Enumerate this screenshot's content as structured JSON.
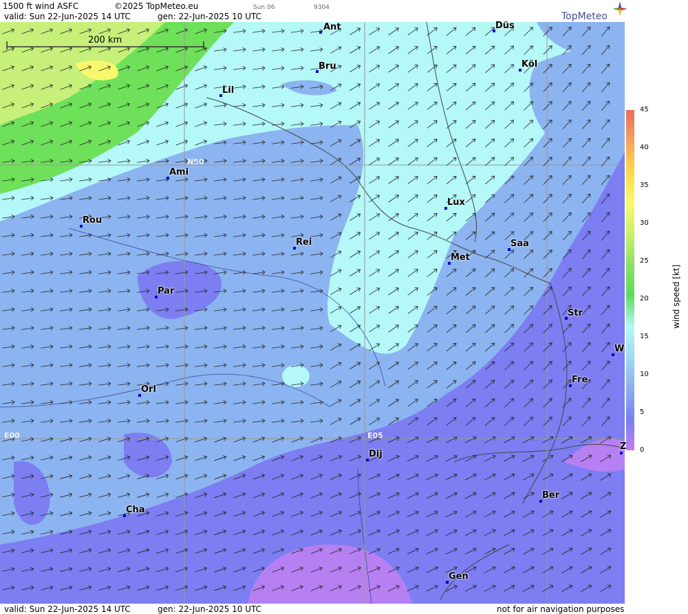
{
  "header": {
    "title": "1500 ft wind ASFC",
    "copyright": "©2025 TopMeteo.eu",
    "run_label": "Sun 06",
    "code": "9304",
    "valid_top": "valid:  Sun  22-Jun-2025  14 UTC",
    "gen_top": "gen: 22-Jun-2025 10 UTC",
    "logo": "TopMeteo"
  },
  "footer": {
    "valid": "valid:  Sun  22-Jun-2025  14 UTC",
    "gen": "gen: 22-Jun-2025 10 UTC",
    "disclaimer": "not for air navigation purposes"
  },
  "scale": {
    "label": "200 km"
  },
  "grid_labels": {
    "n50": "N50",
    "e00": "E00",
    "e05": "E05"
  },
  "cities": [
    {
      "name": "Ant"
    },
    {
      "name": "Düs"
    },
    {
      "name": "Köl"
    },
    {
      "name": "Bru"
    },
    {
      "name": "Lil"
    },
    {
      "name": "Ami"
    },
    {
      "name": "Rou"
    },
    {
      "name": "Rei"
    },
    {
      "name": "Lux"
    },
    {
      "name": "Saa"
    },
    {
      "name": "Met"
    },
    {
      "name": "Par"
    },
    {
      "name": "Str"
    },
    {
      "name": "W"
    },
    {
      "name": "Fre"
    },
    {
      "name": "Orl"
    },
    {
      "name": "Dij"
    },
    {
      "name": "Ber"
    },
    {
      "name": "Cha"
    },
    {
      "name": "Gen"
    },
    {
      "name": "Z"
    }
  ],
  "legend": {
    "title": "wind  speed  [kt]",
    "ticks": [
      "45",
      "40",
      "35",
      "30",
      "25",
      "20",
      "15",
      "10",
      "5",
      "0"
    ],
    "colors": [
      "#e8705a",
      "#f7a15e",
      "#ffd84a",
      "#f9f86c",
      "#cdf06a",
      "#8ce06a",
      "#5cdc5e",
      "#b4f8f8",
      "#a0d8f0",
      "#8ab0f0",
      "#7a7ef0",
      "#c080f0"
    ]
  },
  "colors": {
    "light_cyan": "#b4f8f8",
    "light_blue": "#8cb4f0",
    "medium_blue": "#7c7ef2",
    "violet": "#b680f2",
    "green": "#6ee05a",
    "yellow_green": "#c6f07a"
  }
}
